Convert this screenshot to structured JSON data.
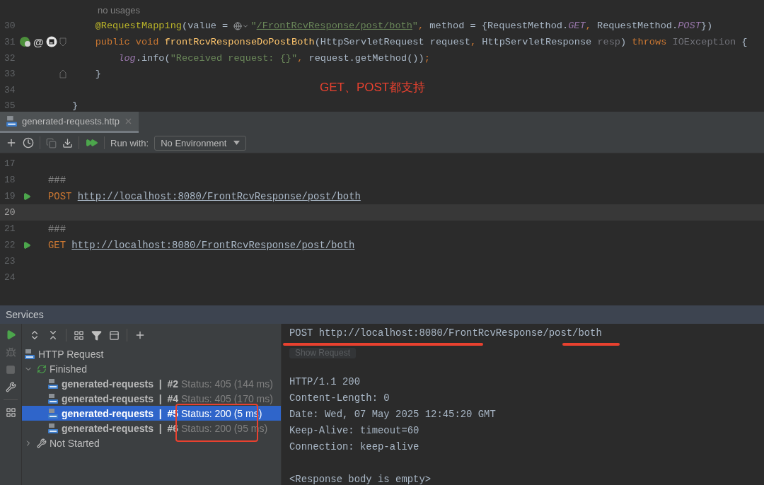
{
  "editor": {
    "hint": "no usages",
    "lines": [
      {
        "number": "30",
        "fold_start": false,
        "fold_end": false,
        "tokens": [
          {
            "kind": "annotation",
            "text": "    @RequestMapping"
          },
          {
            "kind": "plain",
            "text": "(value = "
          },
          {
            "kind": "globe"
          },
          {
            "kind": "string",
            "text": "\""
          },
          {
            "kind": "link",
            "text": "/FrontRcvResponse/post/both"
          },
          {
            "kind": "string",
            "text": "\""
          },
          {
            "kind": "keyword",
            "text": ", "
          },
          {
            "kind": "plain",
            "text": "method = {RequestMethod."
          },
          {
            "kind": "constant",
            "text": "GET"
          },
          {
            "kind": "keyword",
            "text": ", "
          },
          {
            "kind": "plain",
            "text": "RequestMethod."
          },
          {
            "kind": "constant",
            "text": "POST"
          },
          {
            "kind": "plain",
            "text": "})"
          }
        ]
      },
      {
        "number": "31",
        "gutter_symbol": "@",
        "fold_start": true,
        "fold_end": false,
        "tokens": [
          {
            "kind": "keyword",
            "text": "    public void "
          },
          {
            "kind": "function",
            "text": "frontRcvResponseDoPostBoth"
          },
          {
            "kind": "plain",
            "text": "(HttpServletRequest request"
          },
          {
            "kind": "keyword",
            "text": ", "
          },
          {
            "kind": "plain",
            "text": "HttpServletResponse "
          },
          {
            "kind": "unused",
            "text": "resp"
          },
          {
            "kind": "plain",
            "text": ") "
          },
          {
            "kind": "keyword",
            "text": "throws "
          },
          {
            "kind": "unused",
            "text": "IOException"
          },
          {
            "kind": "plain",
            "text": " {"
          }
        ]
      },
      {
        "number": "32",
        "fold_start": false,
        "fold_end": false,
        "tokens": [
          {
            "kind": "field",
            "text": "        log"
          },
          {
            "kind": "plain",
            "text": ".info("
          },
          {
            "kind": "string",
            "text": "\"Received request: {}\""
          },
          {
            "kind": "keyword",
            "text": ", "
          },
          {
            "kind": "plain",
            "text": "request.getMethod())"
          },
          {
            "kind": "keyword",
            "text": ";"
          }
        ]
      },
      {
        "number": "33",
        "fold_start": false,
        "fold_end": true,
        "tokens": [
          {
            "kind": "plain",
            "text": "    }"
          }
        ]
      },
      {
        "number": "34",
        "fold_start": false,
        "fold_end": false
      },
      {
        "number": "35",
        "fold_start": false,
        "fold_end": false,
        "tokens": [
          {
            "kind": "plain",
            "text": "}"
          }
        ]
      }
    ]
  },
  "annotation": {
    "text": "GET、POST都支持"
  },
  "file_tab": {
    "label": "generated-requests.http",
    "selected": true
  },
  "toolbar": {
    "actions": [
      {
        "kind": "add",
        "disabled": false
      },
      {
        "kind": "history",
        "disabled": false
      },
      {
        "kind": "copy",
        "disabled": true
      },
      {
        "kind": "import",
        "disabled": false
      },
      {
        "kind": "run-all",
        "disabled": false
      }
    ],
    "run_with_label": "Run with:",
    "environment": "No Environment"
  },
  "http_editor": {
    "lines": [
      {
        "number": "17",
        "current": false,
        "runnable": false
      },
      {
        "number": "18",
        "current": false,
        "runnable": false,
        "tokens": [
          {
            "kind": "comment",
            "text": "###"
          }
        ]
      },
      {
        "number": "19",
        "current": false,
        "runnable": true,
        "tokens": [
          {
            "kind": "keyword",
            "text": "POST "
          },
          {
            "kind": "url",
            "text": "http://localhost:8080/FrontRcvResponse/post/both"
          }
        ]
      },
      {
        "number": "20",
        "current": true,
        "runnable": false
      },
      {
        "number": "21",
        "current": false,
        "runnable": false,
        "tokens": [
          {
            "kind": "comment",
            "text": "###"
          }
        ]
      },
      {
        "number": "22",
        "current": false,
        "runnable": true,
        "tokens": [
          {
            "kind": "keyword",
            "text": "GET "
          },
          {
            "kind": "url",
            "text": "http://localhost:8080/FrontRcvResponse/post/both"
          }
        ]
      },
      {
        "number": "23",
        "current": false,
        "runnable": false
      },
      {
        "number": "24",
        "current": false,
        "runnable": false
      }
    ]
  },
  "services": {
    "title": "Services",
    "side_actions": [
      {
        "kind": "run",
        "disabled": false
      },
      {
        "kind": "debug",
        "disabled": true
      },
      {
        "kind": "stop",
        "disabled": true
      },
      {
        "kind": "settings",
        "disabled": false
      },
      {
        "kind": "layout",
        "disabled": false
      }
    ],
    "toolbar": [
      {
        "kind": "expand-all"
      },
      {
        "kind": "collapse-all"
      },
      {
        "kind": "group"
      },
      {
        "kind": "filter"
      },
      {
        "kind": "new-tab"
      },
      {
        "kind": "add"
      }
    ],
    "tree": [
      {
        "kind": "root",
        "label": "HTTP Request"
      },
      {
        "kind": "group",
        "label": "Finished",
        "expanded": true,
        "children": [
          {
            "kind": "request",
            "label": "generated-requests  |  #2",
            "status": "Status: 405 (144 ms)",
            "selected": false
          },
          {
            "kind": "request",
            "label": "generated-requests  |  #4",
            "status": "Status: 405 (170 ms)",
            "selected": false
          },
          {
            "kind": "request",
            "label": "generated-requests  |  #5",
            "status": "Status: 200 (5 ms)",
            "selected": true
          },
          {
            "kind": "request",
            "label": "generated-requests  |  #6",
            "status": "Status: 200 (95 ms)",
            "selected": false
          }
        ]
      },
      {
        "kind": "settings-group",
        "label": "Not Started",
        "expanded": false
      }
    ]
  },
  "response": {
    "request_line": "POST http://localhost:8080/FrontRcvResponse/post/both",
    "show_request": "Show Request",
    "headers": [
      "HTTP/1.1 200",
      "Content-Length: 0",
      "Date: Wed, 07 May 2025 12:45:20 GMT",
      "Keep-Alive: timeout=60",
      "Connection: keep-alive"
    ],
    "body": "<Response body is empty>"
  }
}
